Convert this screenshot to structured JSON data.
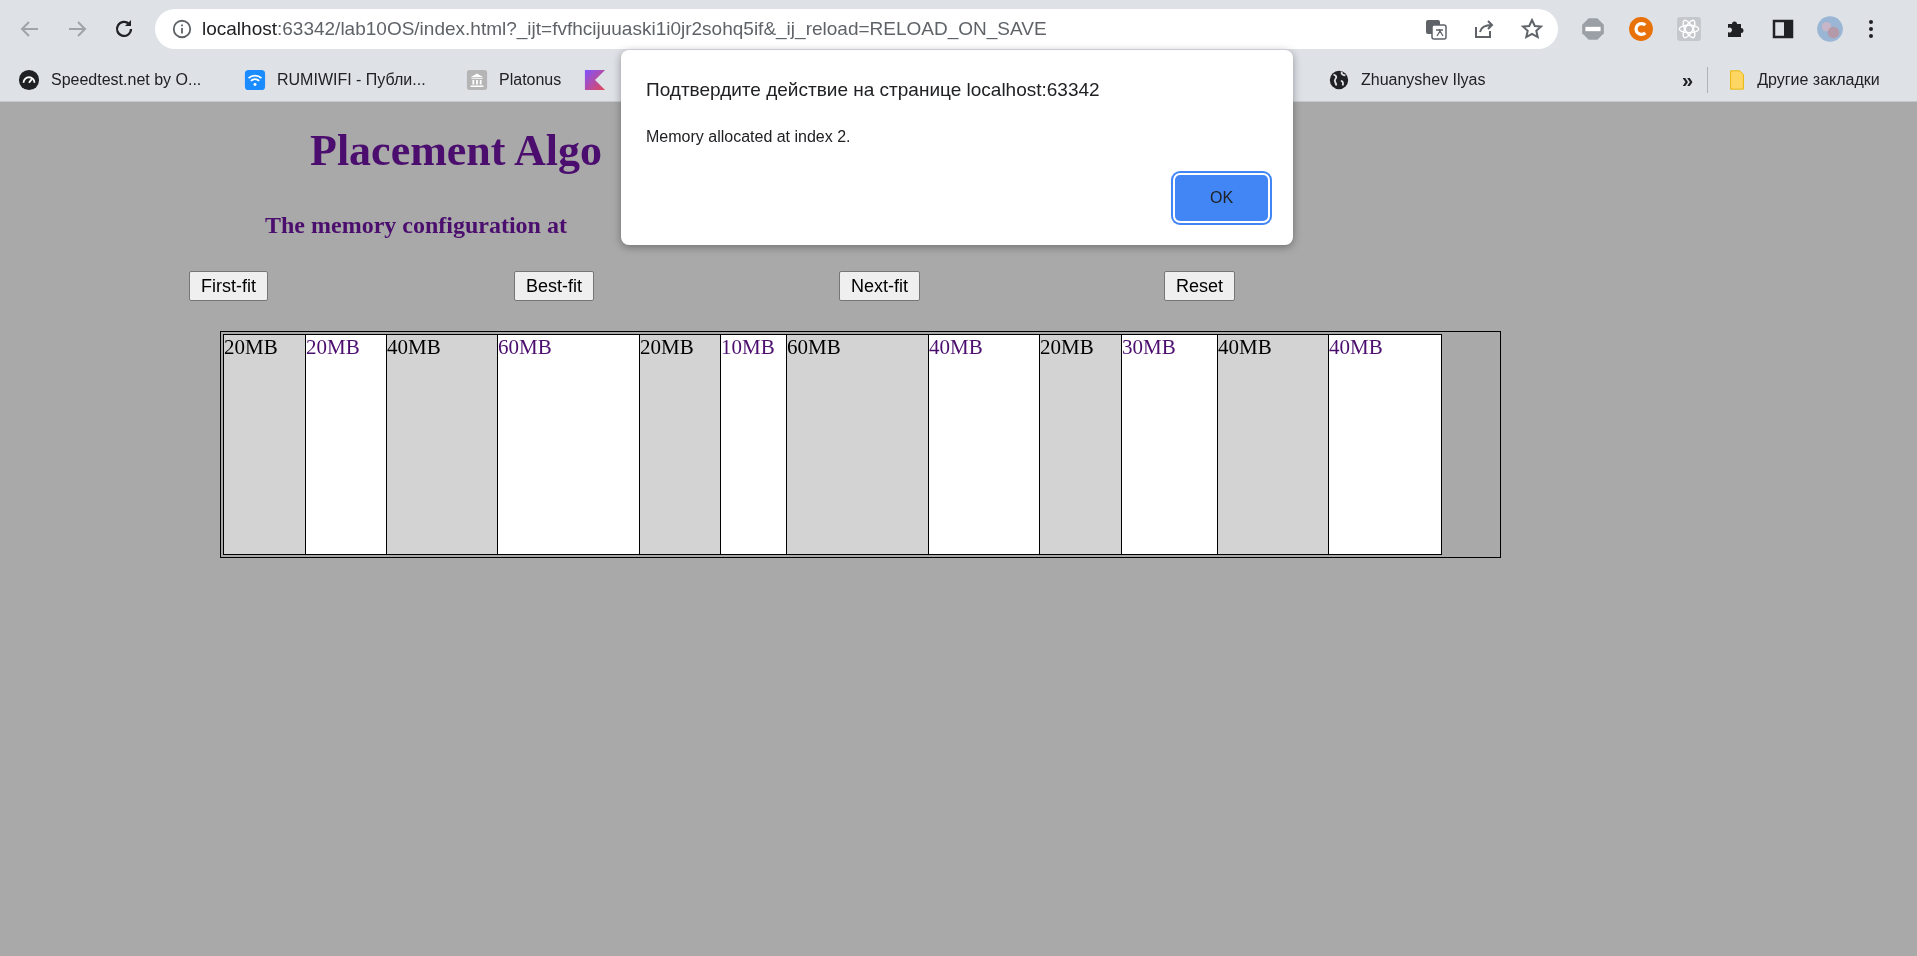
{
  "address_bar": {
    "host": "localhost",
    "path": ":63342/lab10OS/index.html?_ijt=fvfhcijuuaski1i0jr2sohq5if&_ij_reload=RELOAD_ON_SAVE"
  },
  "bookmarks": [
    {
      "label": "Speedtest.net by O..."
    },
    {
      "label": "RUMIWIFI - Публи..."
    },
    {
      "label": "Platonus"
    },
    {
      "label": "Zhuanyshev Ilyas"
    }
  ],
  "other_bookmarks": {
    "overflow": "»",
    "label": "Другие закладки"
  },
  "page": {
    "title": "Placement Algo",
    "subtitle": "The memory configuration at",
    "buttons": [
      "First-fit",
      "Best-fit",
      "Next-fit",
      "Reset"
    ],
    "blocks": [
      {
        "size": "20MB",
        "allocated": true
      },
      {
        "size": "20MB",
        "allocated": false
      },
      {
        "size": "40MB",
        "allocated": true
      },
      {
        "size": "60MB",
        "allocated": false
      },
      {
        "size": "20MB",
        "allocated": true
      },
      {
        "size": "10MB",
        "allocated": false
      },
      {
        "size": "60MB",
        "allocated": true
      },
      {
        "size": "40MB",
        "allocated": false
      },
      {
        "size": "20MB",
        "allocated": true
      },
      {
        "size": "30MB",
        "allocated": false
      },
      {
        "size": "40MB",
        "allocated": true
      },
      {
        "size": "40MB",
        "allocated": false
      }
    ]
  },
  "dialog": {
    "title": "Подтвердите действие на странице localhost:63342",
    "message": "Memory allocated at index 2.",
    "button": "OK"
  }
}
